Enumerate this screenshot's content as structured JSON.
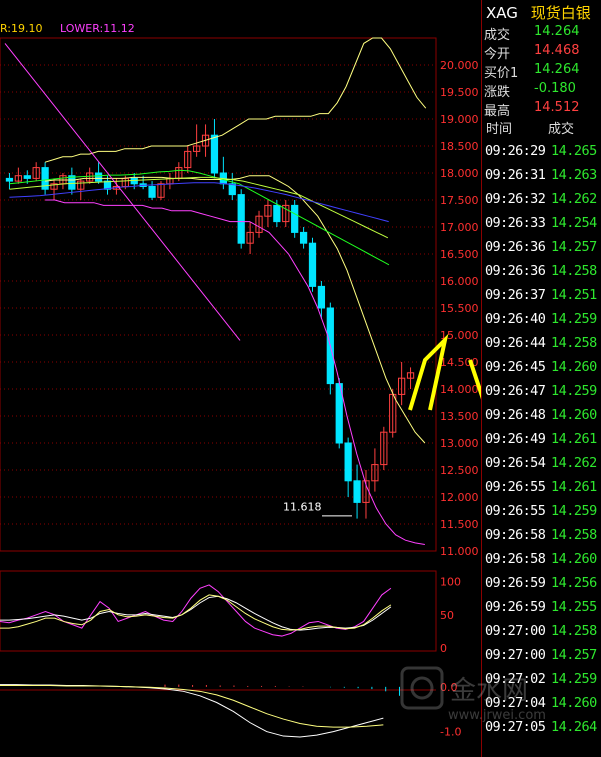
{
  "indicator_bar": {
    "up_label": "R:19.10",
    "lower_label": "LOWER:11.12"
  },
  "header": {
    "symbol": "XAG",
    "name": "现货白银"
  },
  "quote": [
    {
      "label": "成交",
      "value": "14.264",
      "color": "dn"
    },
    {
      "label": "今开",
      "value": "14.468",
      "color": "up"
    },
    {
      "label": "买价1",
      "value": "14.264",
      "color": "dn"
    },
    {
      "label": "涨跌",
      "value": "-0.180",
      "color": "dn"
    },
    {
      "label": "最高",
      "value": "14.512",
      "color": "up"
    }
  ],
  "ticks_header": {
    "time": "时间",
    "price": "成交"
  },
  "ticks": [
    {
      "time": "09:26:29",
      "price": "14.265"
    },
    {
      "time": "09:26:31",
      "price": "14.263"
    },
    {
      "time": "09:26:32",
      "price": "14.262"
    },
    {
      "time": "09:26:33",
      "price": "14.254"
    },
    {
      "time": "09:26:36",
      "price": "14.257"
    },
    {
      "time": "09:26:36",
      "price": "14.258"
    },
    {
      "time": "09:26:37",
      "price": "14.251"
    },
    {
      "time": "09:26:40",
      "price": "14.259"
    },
    {
      "time": "09:26:44",
      "price": "14.258"
    },
    {
      "time": "09:26:45",
      "price": "14.260"
    },
    {
      "time": "09:26:47",
      "price": "14.259"
    },
    {
      "time": "09:26:48",
      "price": "14.260"
    },
    {
      "time": "09:26:49",
      "price": "14.261"
    },
    {
      "time": "09:26:54",
      "price": "14.262"
    },
    {
      "time": "09:26:55",
      "price": "14.261"
    },
    {
      "time": "09:26:55",
      "price": "14.259"
    },
    {
      "time": "09:26:58",
      "price": "14.258"
    },
    {
      "time": "09:26:58",
      "price": "14.260"
    },
    {
      "time": "09:26:59",
      "price": "14.256"
    },
    {
      "time": "09:26:59",
      "price": "14.255"
    },
    {
      "time": "09:27:00",
      "price": "14.258"
    },
    {
      "time": "09:27:00",
      "price": "14.257"
    },
    {
      "time": "09:27:02",
      "price": "14.259"
    },
    {
      "time": "09:27:04",
      "price": "14.260"
    },
    {
      "time": "09:27:05",
      "price": "14.264"
    }
  ],
  "watermark": {
    "text": "金水网",
    "url": "www.jrwei.com"
  },
  "colors": {
    "up": "#ff4040",
    "down": "#00e5ff",
    "grid": "#8b0000",
    "ma1": "#ffff80",
    "ma2": "#ffffff",
    "ma3": "#20ff20",
    "ma4": "#ff40ff",
    "ma5": "#4040ff"
  },
  "chart_data": [
    {
      "type": "candlestick",
      "ylim": [
        11.0,
        20.5
      ],
      "yticks": [
        "20.000",
        "19.500",
        "19.000",
        "18.500",
        "18.000",
        "17.500",
        "17.000",
        "16.500",
        "16.000",
        "15.500",
        "15.000",
        "14.500",
        "14.000",
        "13.500",
        "13.000",
        "12.500",
        "12.000",
        "11.500",
        "11.000"
      ],
      "annotation": "11.618",
      "candles": [
        [
          17.9,
          18.0,
          17.7,
          17.85
        ],
        [
          17.85,
          18.1,
          17.8,
          17.95
        ],
        [
          17.95,
          18.05,
          17.8,
          17.9
        ],
        [
          17.9,
          18.2,
          17.85,
          18.1
        ],
        [
          18.1,
          18.2,
          17.6,
          17.7
        ],
        [
          17.7,
          17.9,
          17.5,
          17.8
        ],
        [
          17.8,
          18.0,
          17.7,
          17.95
        ],
        [
          17.95,
          18.1,
          17.6,
          17.7
        ],
        [
          17.7,
          17.9,
          17.5,
          17.85
        ],
        [
          17.85,
          18.1,
          17.8,
          18.0
        ],
        [
          18.0,
          18.2,
          17.8,
          17.85
        ],
        [
          17.85,
          17.95,
          17.6,
          17.7
        ],
        [
          17.7,
          17.9,
          17.6,
          17.75
        ],
        [
          17.75,
          17.95,
          17.7,
          17.9
        ],
        [
          17.9,
          18.0,
          17.7,
          17.8
        ],
        [
          17.8,
          17.95,
          17.7,
          17.75
        ],
        [
          17.75,
          17.85,
          17.5,
          17.55
        ],
        [
          17.55,
          17.85,
          17.5,
          17.8
        ],
        [
          17.8,
          18.0,
          17.7,
          17.9
        ],
        [
          17.9,
          18.2,
          17.85,
          18.1
        ],
        [
          18.1,
          18.5,
          18.0,
          18.4
        ],
        [
          18.4,
          18.9,
          18.3,
          18.5
        ],
        [
          18.5,
          18.9,
          18.3,
          18.7
        ],
        [
          18.7,
          19.0,
          17.9,
          18.0
        ],
        [
          18.0,
          18.3,
          17.7,
          17.8
        ],
        [
          17.8,
          18.0,
          17.5,
          17.6
        ],
        [
          17.6,
          17.7,
          16.6,
          16.7
        ],
        [
          16.7,
          17.1,
          16.5,
          16.9
        ],
        [
          16.9,
          17.3,
          16.8,
          17.2
        ],
        [
          17.2,
          17.5,
          17.0,
          17.4
        ],
        [
          17.4,
          17.5,
          17.0,
          17.1
        ],
        [
          17.1,
          17.5,
          17.0,
          17.4
        ],
        [
          17.4,
          17.5,
          16.8,
          16.9
        ],
        [
          16.9,
          17.0,
          16.6,
          16.7
        ],
        [
          16.7,
          16.8,
          15.8,
          15.9
        ],
        [
          15.9,
          16.0,
          15.3,
          15.5
        ],
        [
          15.5,
          15.6,
          13.9,
          14.1
        ],
        [
          14.1,
          14.2,
          12.9,
          13.0
        ],
        [
          13.0,
          13.1,
          12.0,
          12.3
        ],
        [
          12.3,
          12.6,
          11.6,
          11.9
        ],
        [
          11.9,
          12.5,
          11.6,
          12.3
        ],
        [
          12.3,
          12.9,
          12.1,
          12.6
        ],
        [
          12.6,
          13.3,
          12.5,
          13.2
        ],
        [
          13.2,
          14.0,
          13.1,
          13.9
        ],
        [
          13.9,
          14.5,
          13.7,
          14.2
        ],
        [
          14.2,
          14.4,
          14.0,
          14.3
        ]
      ],
      "series": [
        {
          "name": "UPPER",
          "values": [
            18.2,
            18.25,
            18.3,
            18.3,
            18.35,
            18.35,
            18.4,
            18.4,
            18.4,
            18.45,
            18.45,
            18.45,
            18.5,
            18.5,
            18.5,
            18.5,
            18.5,
            18.55,
            18.6,
            18.65,
            18.7,
            18.8,
            18.9,
            19.0,
            19.0,
            19.0,
            19.05,
            19.05,
            19.05,
            19.05,
            19.05,
            19.1,
            19.1,
            19.3,
            19.6,
            20.0,
            20.4,
            20.5,
            20.5,
            20.3,
            20.0,
            19.7,
            19.4,
            19.2
          ]
        },
        {
          "name": "LOWER",
          "values": [
            17.5,
            17.5,
            17.45,
            17.45,
            17.45,
            17.45,
            17.4,
            17.4,
            17.4,
            17.4,
            17.4,
            17.35,
            17.35,
            17.3,
            17.3,
            17.3,
            17.25,
            17.2,
            17.15,
            17.1,
            17.1,
            17.1,
            17.0,
            16.9,
            16.7,
            16.5,
            16.2,
            15.9,
            15.5,
            15.0,
            14.3,
            13.5,
            12.8,
            12.2,
            11.8,
            11.5,
            11.3,
            11.2,
            11.15,
            11.12
          ]
        },
        {
          "name": "MID",
          "values": [
            17.85,
            17.87,
            17.87,
            17.87,
            17.9,
            17.9,
            17.9,
            17.9,
            17.9,
            17.92,
            17.92,
            17.92,
            17.92,
            17.9,
            17.9,
            17.9,
            17.88,
            17.88,
            17.88,
            17.88,
            17.9,
            17.95,
            17.95,
            17.95,
            17.85,
            17.75,
            17.6,
            17.4,
            17.2,
            16.9,
            16.6,
            16.2,
            15.7,
            15.2,
            14.7,
            14.2,
            13.8,
            13.5,
            13.2,
            13.0
          ]
        },
        {
          "name": "MA-A",
          "values": [
            17.8,
            17.82,
            17.84,
            17.86,
            17.88,
            17.9,
            17.92,
            17.93,
            17.94,
            17.95,
            17.96,
            17.96,
            17.97,
            17.98,
            18.0,
            18.02,
            18.03,
            18.05,
            18.04,
            18.0,
            17.95,
            17.9,
            17.85,
            17.8,
            17.7,
            17.6,
            17.5,
            17.4,
            17.3,
            17.2,
            17.1,
            17.0,
            16.9,
            16.8,
            16.7,
            16.6,
            16.5,
            16.4,
            16.3
          ]
        },
        {
          "name": "MA-B",
          "values": [
            17.7,
            17.72,
            17.74,
            17.76,
            17.78,
            17.8,
            17.81,
            17.82,
            17.83,
            17.84,
            17.85,
            17.86,
            17.87,
            17.88,
            17.89,
            17.9,
            17.91,
            17.92,
            17.92,
            17.9,
            17.88,
            17.85,
            17.8,
            17.75,
            17.7,
            17.65,
            17.6,
            17.5,
            17.4,
            17.3,
            17.2,
            17.1,
            17.0,
            16.9,
            16.8
          ]
        },
        {
          "name": "MA-C",
          "values": [
            17.55,
            17.56,
            17.57,
            17.58,
            17.6,
            17.62,
            17.64,
            17.66,
            17.68,
            17.7,
            17.72,
            17.74,
            17.75,
            17.77,
            17.78,
            17.79,
            17.8,
            17.81,
            17.82,
            17.82,
            17.82,
            17.8,
            17.78,
            17.75,
            17.72,
            17.68,
            17.64,
            17.6,
            17.55,
            17.5,
            17.45,
            17.4,
            17.35,
            17.3,
            17.25,
            17.2,
            17.15,
            17.1
          ]
        }
      ]
    },
    {
      "type": "line",
      "yticks": [
        "100",
        "50",
        "0"
      ],
      "ylim": [
        0,
        110
      ],
      "series": [
        {
          "name": "K",
          "values": [
            40,
            38,
            42,
            45,
            50,
            55,
            50,
            40,
            35,
            30,
            50,
            70,
            60,
            40,
            45,
            50,
            55,
            48,
            42,
            40,
            55,
            75,
            90,
            95,
            85,
            70,
            55,
            40,
            30,
            25,
            20,
            18,
            22,
            30,
            38,
            40,
            35,
            30,
            28,
            32,
            40,
            60,
            80,
            90
          ]
        },
        {
          "name": "D",
          "values": [
            42,
            42,
            43,
            44,
            46,
            48,
            50,
            48,
            45,
            42,
            45,
            52,
            55,
            52,
            50,
            50,
            52,
            50,
            48,
            46,
            50,
            58,
            68,
            76,
            78,
            74,
            68,
            60,
            52,
            45,
            38,
            32,
            28,
            27,
            28,
            30,
            31,
            31,
            30,
            31,
            34,
            42,
            52,
            62
          ]
        },
        {
          "name": "J",
          "values": [
            30,
            30,
            32,
            36,
            40,
            45,
            45,
            40,
            37,
            35,
            42,
            55,
            58,
            50,
            47,
            48,
            50,
            48,
            46,
            45,
            50,
            60,
            72,
            80,
            78,
            72,
            62,
            52,
            44,
            38,
            32,
            28,
            27,
            28,
            31,
            33,
            33,
            31,
            29,
            30,
            35,
            45,
            56,
            65
          ]
        }
      ]
    },
    {
      "type": "bar",
      "yticks": [
        "0.0",
        "-1.0"
      ],
      "ylim": [
        -1.3,
        0.6
      ],
      "values": [
        0.05,
        0.05,
        0.04,
        0.04,
        0.03,
        0.03,
        0.02,
        0.02,
        0.02,
        0.01,
        0.01,
        0.0,
        -0.01,
        -0.02,
        -0.03,
        -0.05,
        -0.1,
        -0.2,
        -0.3,
        -0.45,
        -0.6,
        -0.75,
        -0.8,
        -0.75,
        -0.65,
        -0.5,
        -0.3,
        -0.1,
        0.05
      ],
      "series": [
        {
          "name": "DIF",
          "values": [
            0.05,
            0.05,
            0.04,
            0.04,
            0.03,
            0.03,
            0.02,
            0.01,
            0.0,
            -0.02,
            -0.05,
            -0.1,
            -0.2,
            -0.35,
            -0.55,
            -0.8,
            -1.0,
            -1.1,
            -1.12,
            -1.08,
            -1.0,
            -0.9,
            -0.8,
            -0.7
          ]
        },
        {
          "name": "DEA",
          "values": [
            0.03,
            0.03,
            0.03,
            0.03,
            0.02,
            0.02,
            0.02,
            0.01,
            0.0,
            -0.01,
            -0.03,
            -0.06,
            -0.1,
            -0.18,
            -0.3,
            -0.45,
            -0.6,
            -0.72,
            -0.82,
            -0.88,
            -0.9,
            -0.9,
            -0.88,
            -0.85
          ]
        }
      ]
    }
  ]
}
